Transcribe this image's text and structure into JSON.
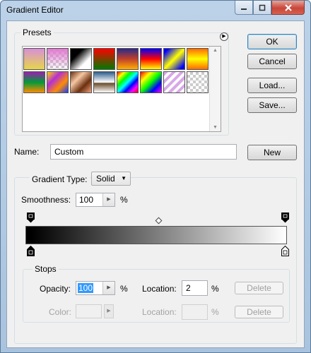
{
  "window": {
    "title": "Gradient Editor"
  },
  "presets": {
    "label": "Presets",
    "swatches": [
      "fg-to-bg",
      "fg-to-transparent",
      "black-to-white",
      "red-green",
      "violet-orange",
      "blue-red-yellow",
      "blue-yellow-blue",
      "orange-yellow-orange",
      "violet-green-orange",
      "yellow-violet-orange-blue",
      "copper",
      "chrome",
      "spectrum",
      "transparent-rainbow",
      "transparent-stripes",
      "transparent"
    ]
  },
  "buttons": {
    "ok": "OK",
    "cancel": "Cancel",
    "load": "Load...",
    "save": "Save...",
    "new": "New"
  },
  "name": {
    "label": "Name:",
    "value": "Custom"
  },
  "gradient": {
    "type_label": "Gradient Type:",
    "type_value": "Solid",
    "smoothness_label": "Smoothness:",
    "smoothness_value": "100",
    "smoothness_unit": "%",
    "colors": {
      "start": "#000000",
      "end": "#ffffff"
    }
  },
  "stops": {
    "label": "Stops",
    "opacity_label": "Opacity:",
    "opacity_value": "100",
    "opacity_unit": "%",
    "opacity_location_label": "Location:",
    "opacity_location_value": "2",
    "opacity_location_unit": "%",
    "delete_label": "Delete",
    "color_label": "Color:",
    "color_location_label": "Location:",
    "color_location_unit": "%",
    "color_delete_label": "Delete"
  }
}
